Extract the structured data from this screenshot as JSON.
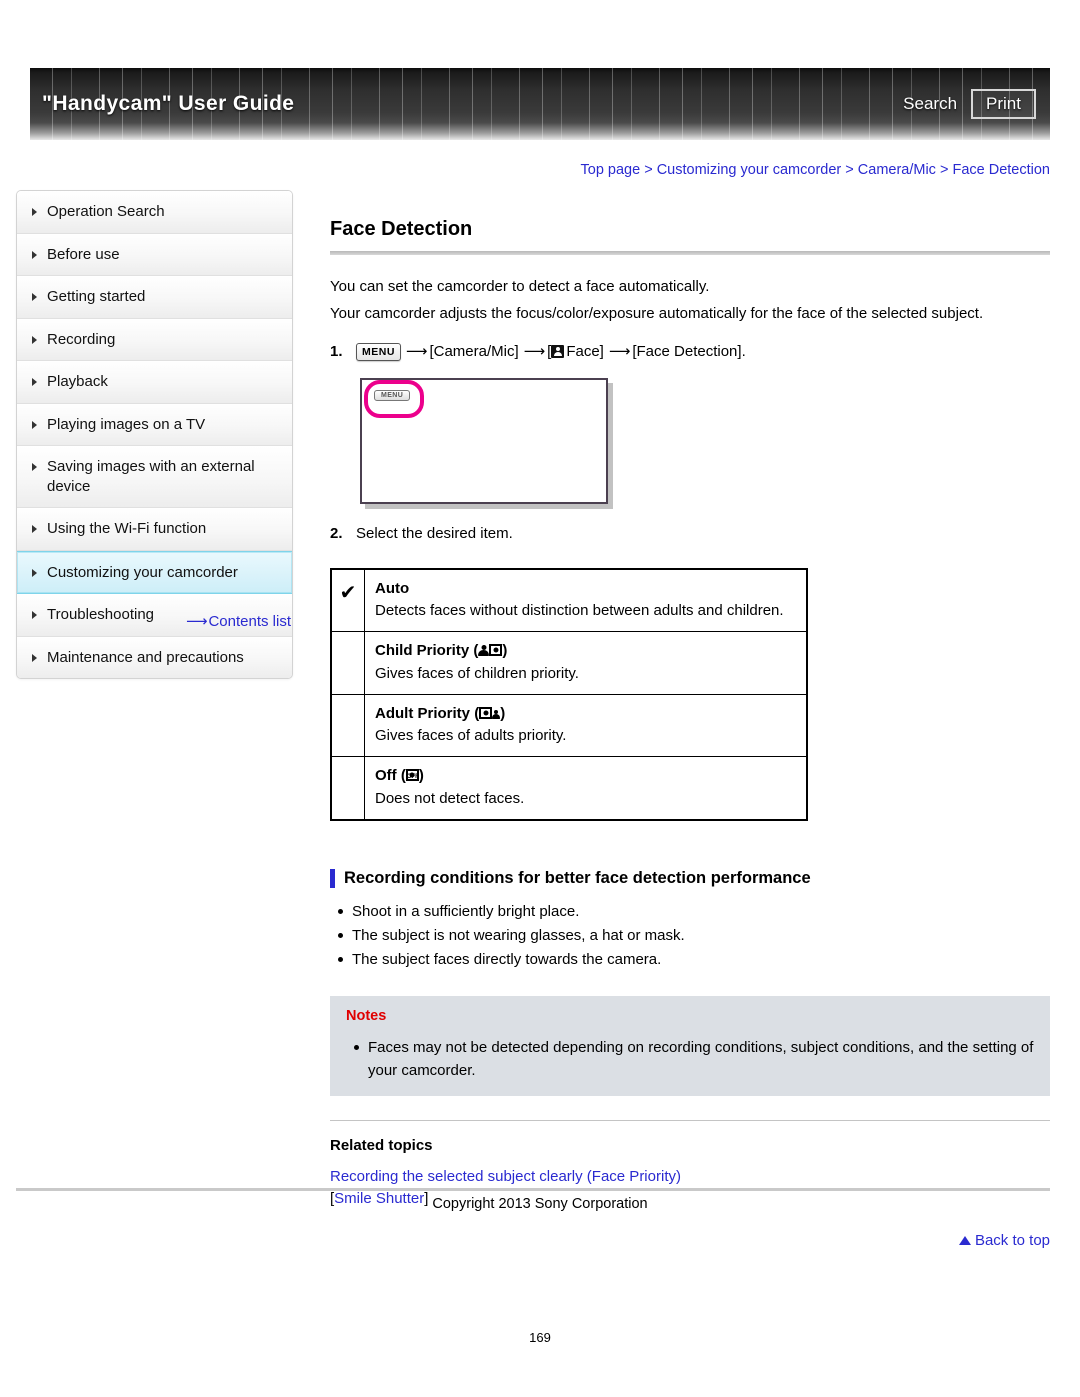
{
  "banner": {
    "title": "\"Handycam\" User Guide",
    "search_label": "Search",
    "print_label": "Print"
  },
  "breadcrumb": {
    "items": [
      "Top page",
      "Customizing your camcorder",
      "Camera/Mic",
      "Face Detection"
    ],
    "separator": ">",
    "full": "Top page > Customizing your camcorder > Camera/Mic > Face Detection"
  },
  "sidebar": {
    "items": [
      {
        "label": "Operation Search",
        "active": false
      },
      {
        "label": "Before use",
        "active": false
      },
      {
        "label": "Getting started",
        "active": false
      },
      {
        "label": "Recording",
        "active": false
      },
      {
        "label": "Playback",
        "active": false
      },
      {
        "label": "Playing images on a TV",
        "active": false
      },
      {
        "label": "Saving images with an external device",
        "active": false
      },
      {
        "label": "Using the Wi-Fi function",
        "active": false
      },
      {
        "label": "Customizing your camcorder",
        "active": true
      },
      {
        "label": "Troubleshooting",
        "active": false
      },
      {
        "label": "Maintenance and precautions",
        "active": false
      }
    ],
    "contents_link": "Contents list"
  },
  "main": {
    "title": "Face Detection",
    "intro_line1": "You can set the camcorder to detect a face automatically.",
    "intro_line2": "Your camcorder adjusts the focus/color/exposure automatically for the face of the selected subject.",
    "steps": [
      {
        "num": "1.",
        "menu_chip": "MENU",
        "part1": "[Camera/Mic]",
        "part2": "Face]",
        "bracket_open": "[",
        "part3": "[Face Detection]."
      },
      {
        "num": "2.",
        "text": "Select the desired item."
      }
    ],
    "lcd": {
      "menu_label": "MENU",
      "highlight_color": "#ec008c"
    },
    "options_table": {
      "rows": [
        {
          "checked": true,
          "check_mark": "✔",
          "name": "Auto",
          "icon": "none",
          "desc": "Detects faces without distinction between adults and children."
        },
        {
          "checked": false,
          "check_mark": "",
          "name": "Child Priority",
          "icon": "child-priority",
          "desc": "Gives faces of children priority."
        },
        {
          "checked": false,
          "check_mark": "",
          "name": "Adult Priority",
          "icon": "adult-priority",
          "desc": "Gives faces of adults priority."
        },
        {
          "checked": false,
          "check_mark": "",
          "name": "Off",
          "icon": "face-off",
          "desc": "Does not detect faces."
        }
      ]
    },
    "section": {
      "heading": "Recording conditions for better face detection performance",
      "accent_color": "#2a2ad0",
      "bullets": [
        "Shoot in a sufficiently bright place.",
        "The subject is not wearing glasses, a hat or mask.",
        "The subject faces directly towards the camera."
      ]
    },
    "notes": {
      "title": "Notes",
      "title_color": "#e00000",
      "background": "#dbdfe4",
      "bullets": [
        "Faces may not be detected depending on recording conditions, subject conditions, and the setting of your camcorder."
      ]
    },
    "related": {
      "title": "Related topics",
      "links": [
        {
          "text": "Recording the selected subject clearly (Face Priority)",
          "bracketed": false
        },
        {
          "text": "Smile Shutter",
          "bracketed": true
        }
      ]
    },
    "back_to_top": "Back to top"
  },
  "footer": {
    "copyright": "Copyright 2013 Sony Corporation",
    "page_number": "169"
  }
}
